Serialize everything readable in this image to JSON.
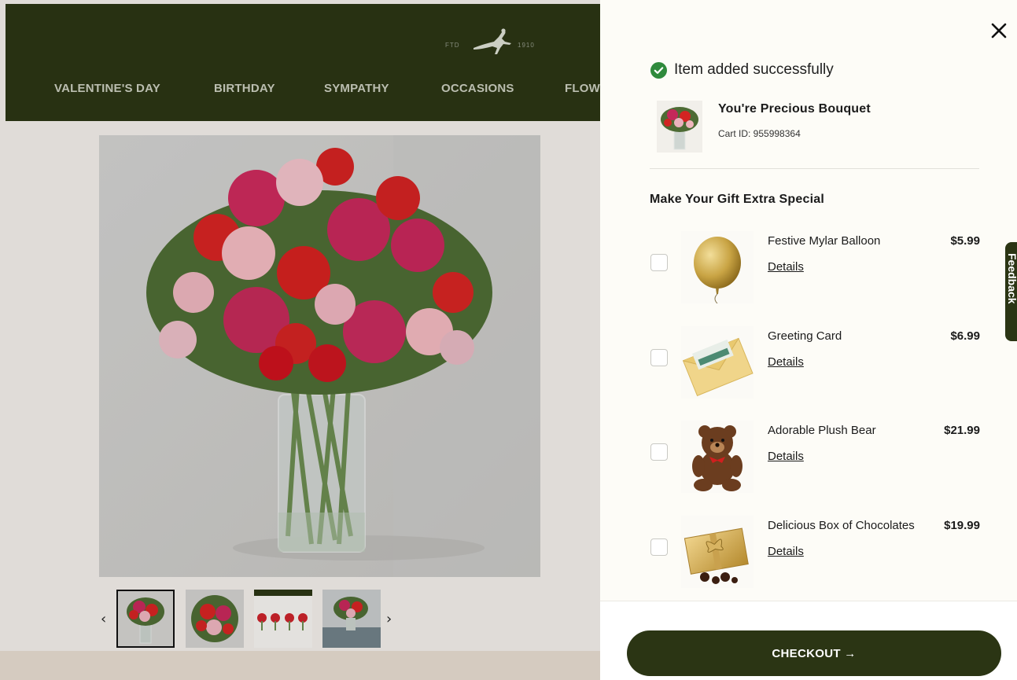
{
  "header": {
    "logo": {
      "left_text": "FTD",
      "right_text": "1910"
    },
    "nav": [
      {
        "label": "VALENTINE'S DAY"
      },
      {
        "label": "BIRTHDAY"
      },
      {
        "label": "SYMPATHY"
      },
      {
        "label": "OCCASIONS"
      },
      {
        "label": "FLOW"
      }
    ]
  },
  "product": {
    "thumbnails": [
      {
        "name": "thumb-bouquet-vase",
        "selected": true
      },
      {
        "name": "thumb-bouquet-top"
      },
      {
        "name": "thumb-sizes"
      },
      {
        "name": "thumb-room"
      }
    ]
  },
  "drawer": {
    "success_message": "Item added successfully",
    "added_item": {
      "name": "You're Precious Bouquet",
      "cart_id": "Cart ID: 955998364"
    },
    "upsell_title": "Make Your Gift Extra Special",
    "addons": [
      {
        "name": "Festive Mylar Balloon",
        "price": "$5.99",
        "details": "Details",
        "icon": "balloon-image"
      },
      {
        "name": "Greeting Card",
        "price": "$6.99",
        "details": "Details",
        "icon": "greeting-card-image"
      },
      {
        "name": "Adorable Plush Bear",
        "price": "$21.99",
        "details": "Details",
        "icon": "plush-bear-image"
      },
      {
        "name": "Delicious Box of Chocolates",
        "price": "$19.99",
        "details": "Details",
        "icon": "chocolates-image"
      }
    ],
    "checkout_label": "CHECKOUT →"
  },
  "feedback": {
    "label": "Feedback"
  },
  "colors": {
    "brand_green": "#2b3514",
    "success_green": "#2f8a3c",
    "drawer_bg": "#fdfcf7"
  }
}
